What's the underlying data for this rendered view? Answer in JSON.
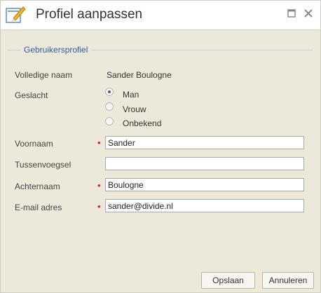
{
  "window": {
    "title": "Profiel aanpassen",
    "icon": "edit-pencil-icon",
    "controls": [
      "maximize-icon",
      "close-icon"
    ]
  },
  "section": {
    "legend": "Gebruikersprofiel"
  },
  "fields": {
    "full_name_label": "Volledige naam",
    "full_name_value": "Sander Boulogne",
    "gender_label": "Geslacht",
    "gender_options": [
      "Man",
      "Vrouw",
      "Onbekend"
    ],
    "gender_selected": "Man",
    "first_name_label": "Voornaam",
    "first_name_value": "Sander",
    "prefix_label": "Tussenvoegsel",
    "prefix_value": "",
    "last_name_label": "Achternaam",
    "last_name_value": "Boulogne",
    "email_label": "E-mail adres",
    "email_value": "sander@divide.nl",
    "required_marker": "•"
  },
  "buttons": {
    "save": "Opslaan",
    "cancel": "Annuleren"
  },
  "colors": {
    "legend": "#2f5da0",
    "required": "#d32020",
    "background": "#ece9da"
  }
}
